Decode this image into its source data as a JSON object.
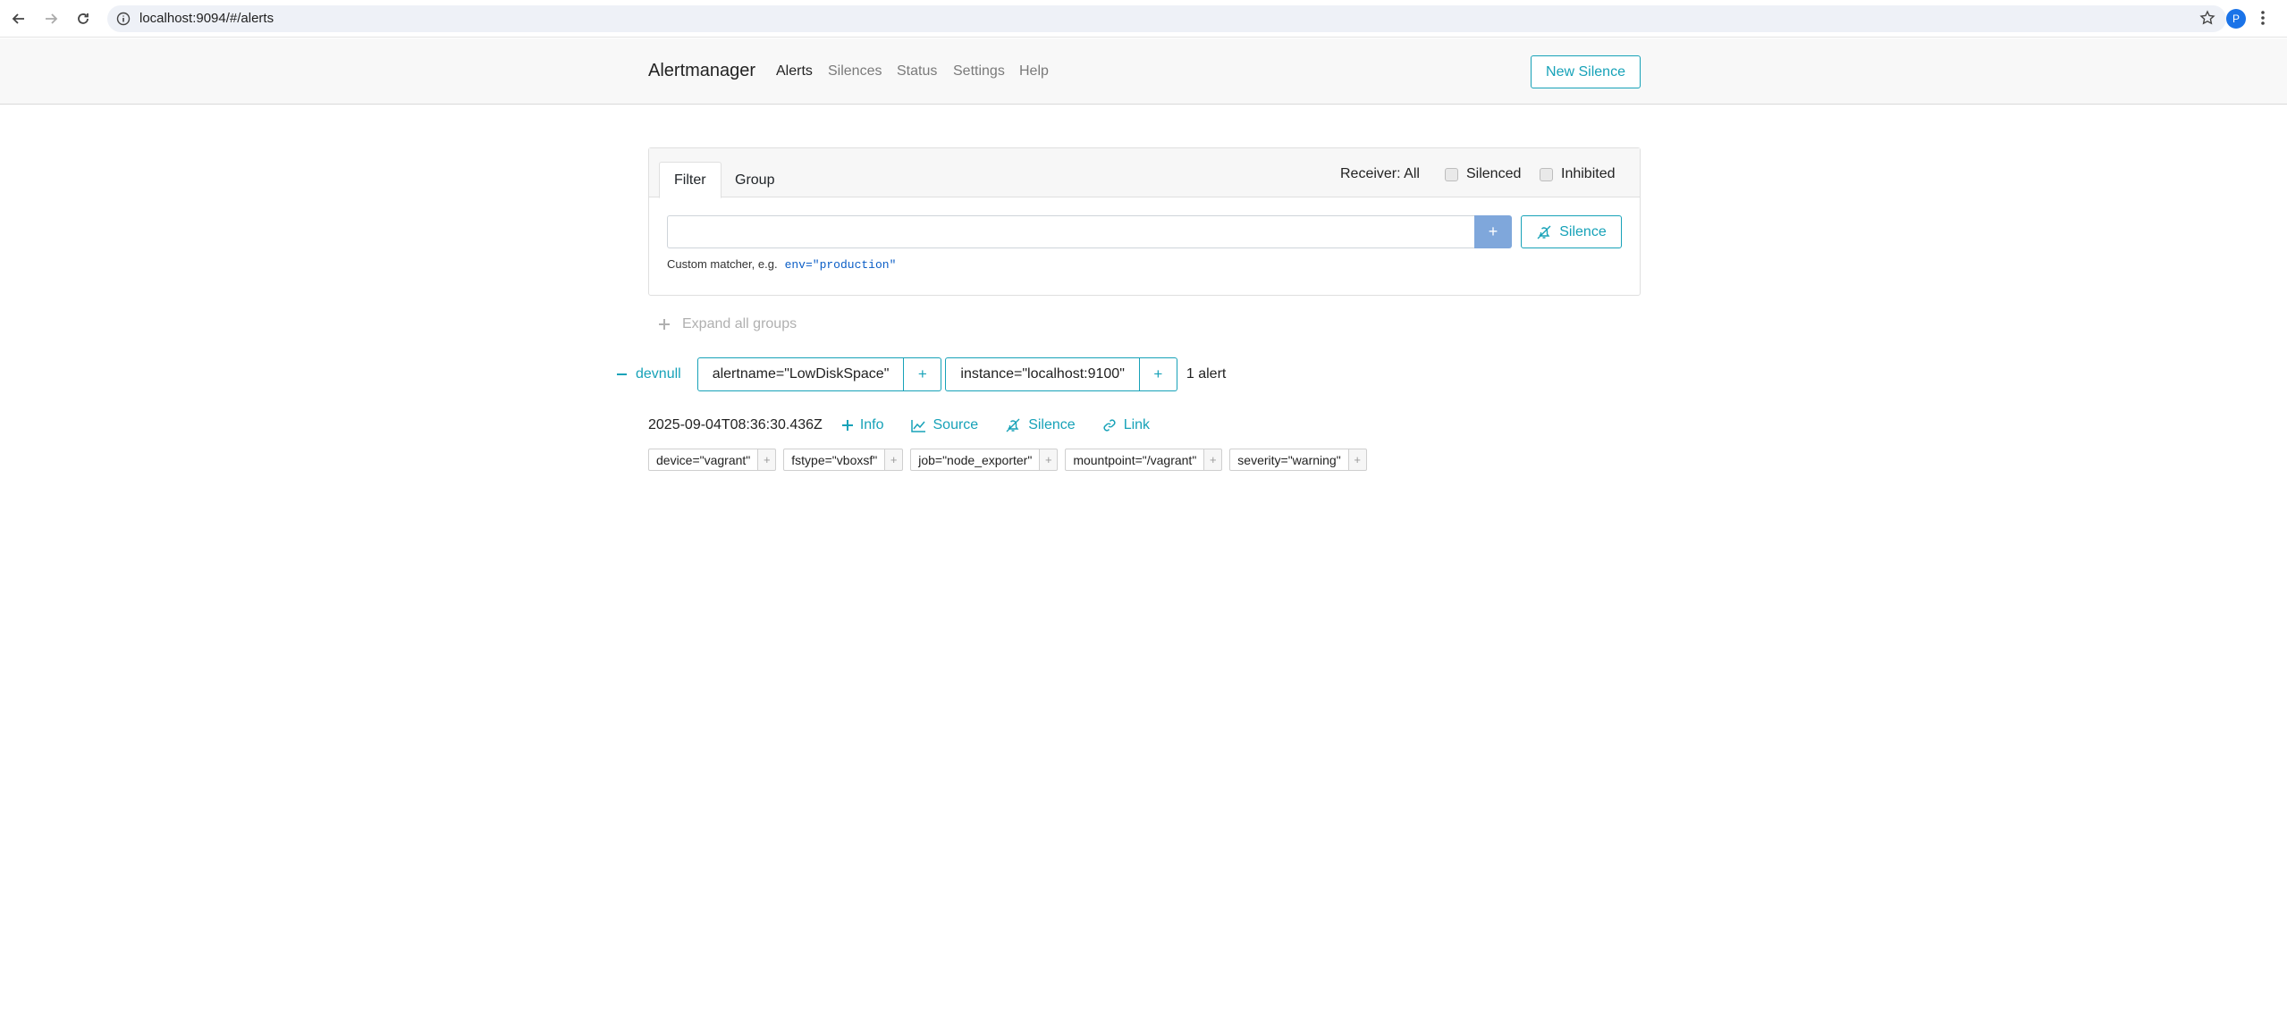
{
  "browser": {
    "url": "localhost:9094/#/alerts",
    "avatar_letter": "P"
  },
  "navbar": {
    "brand": "Alertmanager",
    "links": [
      "Alerts",
      "Silences",
      "Status",
      "Settings",
      "Help"
    ],
    "active_link": "Alerts",
    "new_silence_label": "New Silence"
  },
  "filter": {
    "tabs": [
      "Filter",
      "Group"
    ],
    "active_tab": "Filter",
    "receiver_label": "Receiver: All",
    "silenced_label": "Silenced",
    "inhibited_label": "Inhibited",
    "input_value": "",
    "add_label": "+",
    "silence_label": "Silence",
    "hint_text": "Custom matcher, e.g.",
    "hint_example": "env=\"production\""
  },
  "groups": {
    "expand_all_label": "Expand all groups",
    "receiver_name": "devnull",
    "matchers": [
      "alertname=\"LowDiskSpace\"",
      "instance=\"localhost:9100\""
    ],
    "plus_label": "+",
    "alert_count": "1 alert"
  },
  "alert": {
    "timestamp": "2025-09-04T08:36:30.436Z",
    "actions": [
      "Info",
      "Source",
      "Silence",
      "Link"
    ],
    "labels": [
      "device=\"vagrant\"",
      "fstype=\"vboxsf\"",
      "job=\"node_exporter\"",
      "mountpoint=\"/vagrant\"",
      "severity=\"warning\""
    ],
    "label_plus": "+"
  },
  "colors": {
    "accent": "#17a2b8",
    "primary_button": "#7fa7db",
    "navbar_bg": "#f8f8f8"
  }
}
